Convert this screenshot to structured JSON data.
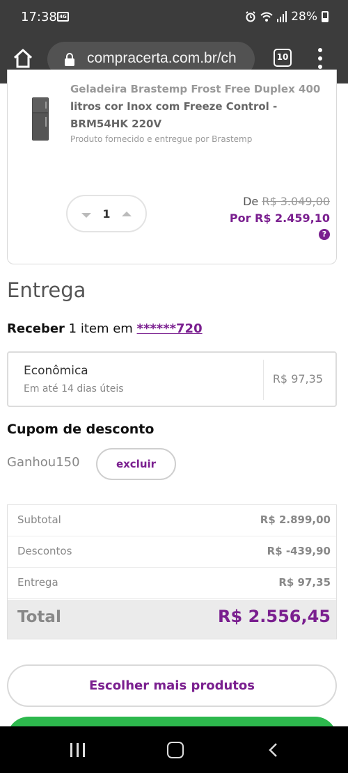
{
  "status_bar": {
    "time": "17:38",
    "battery": "28%",
    "sim_label": "4G"
  },
  "browser": {
    "url": "compracerta.com.br/ch",
    "tab_count": "10"
  },
  "product": {
    "name_faded": "Geladeira Brastemp Frost Free Duplex 400",
    "name_rest": "litros cor Inox com Freeze Control - BRM54HK 220V",
    "seller": "Produto fornecido e entregue por Brastemp",
    "quantity": "1",
    "price_old_prefix": "De",
    "price_old": "R$ 3.049,00",
    "price_new": "Por R$ 2.459,10",
    "help_icon": "?"
  },
  "delivery": {
    "title": "Entrega",
    "receive_bold": "Receber",
    "receive_text": " 1 item em ",
    "receive_code": "******720",
    "option_name": "Econômica",
    "option_time": "Em até 14 dias úteis",
    "option_price": "R$ 97,35"
  },
  "coupon": {
    "title": "Cupom de desconto",
    "code": "Ganhou150",
    "remove_label": "excluir"
  },
  "summary": {
    "rows": [
      {
        "label": "Subtotal",
        "value": "R$ 2.899,00"
      },
      {
        "label": "Descontos",
        "value": "R$ -439,90"
      },
      {
        "label": "Entrega",
        "value": "R$ 97,35"
      }
    ],
    "total_label": "Total",
    "total_value": "R$ 2.556,45"
  },
  "actions": {
    "more_products": "Escolher mais produtos"
  },
  "colors": {
    "accent": "#7a1f8f",
    "checkout": "#2db84d",
    "chrome": "#3c3c3c"
  }
}
